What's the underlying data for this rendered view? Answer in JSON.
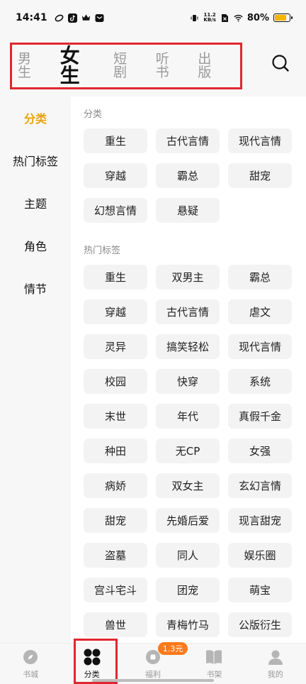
{
  "status": {
    "time": "14:41",
    "net_speed_value": "11.2",
    "net_speed_unit": "KB/s",
    "battery_percent": "80%",
    "battery_level": 0.8
  },
  "top_nav": {
    "tabs": [
      {
        "label": "男生",
        "active": false
      },
      {
        "label": "女生",
        "active": true
      },
      {
        "label": "短剧",
        "active": false
      },
      {
        "label": "听书",
        "active": false
      },
      {
        "label": "出版",
        "active": false
      }
    ],
    "search_icon": "search-icon"
  },
  "sidebar": {
    "items": [
      {
        "label": "分类",
        "active": true
      },
      {
        "label": "热门标签",
        "active": false
      },
      {
        "label": "主题",
        "active": false
      },
      {
        "label": "角色",
        "active": false
      },
      {
        "label": "情节",
        "active": false
      }
    ]
  },
  "content": {
    "section1_title": "分类",
    "section1_tags": [
      "重生",
      "古代言情",
      "现代言情",
      "穿越",
      "霸总",
      "甜宠",
      "幻想言情",
      "悬疑"
    ],
    "section2_title": "热门标签",
    "section2_tags": [
      "重生",
      "双男主",
      "霸总",
      "穿越",
      "古代言情",
      "虐文",
      "灵异",
      "搞笑轻松",
      "现代言情",
      "校园",
      "快穿",
      "系统",
      "末世",
      "年代",
      "真假千金",
      "种田",
      "无CP",
      "女强",
      "病娇",
      "双女主",
      "玄幻言情",
      "甜宠",
      "先婚后爱",
      "现言甜宠",
      "盗墓",
      "同人",
      "娱乐圈",
      "宫斗宅斗",
      "团宠",
      "萌宝",
      "兽世",
      "青梅竹马",
      "公版衍生"
    ]
  },
  "bottom_nav": {
    "items": [
      {
        "label": "书城",
        "icon": "compass-icon",
        "active": false
      },
      {
        "label": "分类",
        "icon": "grid-icon",
        "active": true
      },
      {
        "label": "福利",
        "icon": "coin-icon",
        "active": false,
        "badge": "1.3元"
      },
      {
        "label": "书架",
        "icon": "book-icon",
        "active": false
      },
      {
        "label": "我的",
        "icon": "user-icon",
        "active": false
      }
    ]
  },
  "colors": {
    "accent": "#e8a300",
    "highlight_border": "#e02730",
    "badge": "#ff7a1a"
  }
}
